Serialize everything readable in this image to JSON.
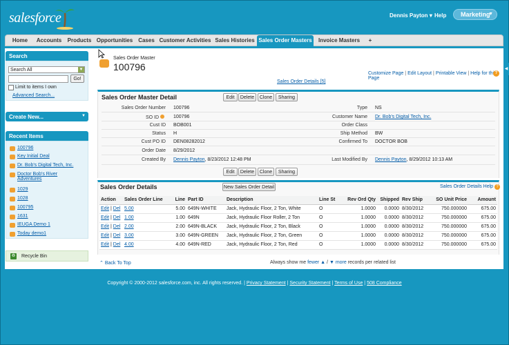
{
  "header": {
    "logo_text": "salesforce",
    "user_name": "Dennis Payton",
    "help_label": "Help",
    "app_menu_label": "Marketing"
  },
  "tabs": [
    {
      "label": "Home"
    },
    {
      "label": "Accounts"
    },
    {
      "label": "Products"
    },
    {
      "label": "Opportunities"
    },
    {
      "label": "Cases"
    },
    {
      "label": "Customer Activities"
    },
    {
      "label": "Sales Histories"
    },
    {
      "label": "Sales Order Masters",
      "active": true
    },
    {
      "label": "Invoice Masters"
    },
    {
      "label": "+"
    }
  ],
  "sidebar": {
    "search_title": "Search",
    "search_scope": "Search All",
    "go_label": "Go!",
    "limit_label": "Limit to items I own",
    "advanced_search": "Advanced Search...",
    "create_new": "Create New...",
    "recent_title": "Recent Items",
    "recent_items": [
      "100796",
      "Key Initial Deal",
      "Dr. Bob's Digital Tech, Inc.",
      "Doctor Bob's River Adventures",
      "1029",
      "1028",
      "100795",
      "1631",
      "IEUGA Demo 1",
      "Today demo1"
    ],
    "recycle_bin": "Recycle Bin"
  },
  "page": {
    "object_type": "Sales Order Master",
    "title": "100796",
    "links": [
      "Customize Page",
      "Edit Layout",
      "Printable View",
      "Help for this Page"
    ],
    "help_icon": "?",
    "details_link": "Sales Order Details [5]"
  },
  "detail": {
    "section_title": "Sales Order Master Detail",
    "buttons": [
      "Edit",
      "Delete",
      "Clone",
      "Sharing"
    ],
    "left_fields": [
      {
        "label": "Sales Order Number",
        "value": "100796"
      },
      {
        "label": "SO ID",
        "value": "100796"
      },
      {
        "label": "Cust ID",
        "value": "BOB001"
      },
      {
        "label": "Status",
        "value": "H"
      },
      {
        "label": "Cust PO ID",
        "value": "DEN08282012"
      },
      {
        "label": "Order Date",
        "value": "8/29/2012"
      },
      {
        "label": "Created By",
        "value": "Dennis Payton",
        "suffix": ", 8/23/2012 12:48 PM"
      }
    ],
    "right_fields": [
      {
        "label": "Type",
        "value": "NS"
      },
      {
        "label": "Customer Name",
        "value": "Dr. Bob's Digital Tech, Inc."
      },
      {
        "label": "Order Class",
        "value": ""
      },
      {
        "label": "Ship Method",
        "value": "BW"
      },
      {
        "label": "Confirmed To",
        "value": "DOCTOR BOB"
      },
      {
        "label": "",
        "value": ""
      },
      {
        "label": "Last Modified By",
        "value": "Dennis Payton",
        "suffix": ", 8/29/2012 10:13 AM"
      }
    ]
  },
  "related": {
    "title": "Sales Order Details",
    "new_button": "New Sales Order Detail",
    "help": "Sales Order Details Help",
    "columns": [
      "Action",
      "Sales Order Line",
      "Line",
      "Part ID",
      "Description",
      "Line St",
      "Rev Ord Qty",
      "Shipped",
      "Rev Ship",
      "SO Unit Price",
      "Amount"
    ],
    "rows": [
      {
        "edit": "Edit",
        "del": "Del",
        "sol": "5.00",
        "line": "5.00",
        "part": "649N-WHITE",
        "desc": "Jack, Hydraulic Floor, 2 Ton, White",
        "st": "O",
        "qty": "1.0000",
        "shipped": "0.0000",
        "rev_ship": "8/30/2012",
        "price": "750.000000",
        "amount": "675.00"
      },
      {
        "edit": "Edit",
        "del": "Del",
        "sol": "1.00",
        "line": "1.00",
        "part": "649N",
        "desc": "Jack, Hydraulic Floor Roller, 2 Ton",
        "st": "O",
        "qty": "1.0000",
        "shipped": "0.0000",
        "rev_ship": "8/30/2012",
        "price": "750.000000",
        "amount": "675.00"
      },
      {
        "edit": "Edit",
        "del": "Del",
        "sol": "2.00",
        "line": "2.00",
        "part": "649N-BLACK",
        "desc": "Jack, Hydraulic Floor, 2 Ton, Black",
        "st": "O",
        "qty": "1.0000",
        "shipped": "0.0000",
        "rev_ship": "8/30/2012",
        "price": "750.000000",
        "amount": "675.00"
      },
      {
        "edit": "Edit",
        "del": "Del",
        "sol": "3.00",
        "line": "3.00",
        "part": "649N-GREEN",
        "desc": "Jack, Hydraulic Floor, 2 Ton, Green",
        "st": "O",
        "qty": "1.0000",
        "shipped": "0.0000",
        "rev_ship": "8/30/2012",
        "price": "750.000000",
        "amount": "675.00"
      },
      {
        "edit": "Edit",
        "del": "Del",
        "sol": "4.00",
        "line": "4.00",
        "part": "649N-RED",
        "desc": "Jack, Hydraulic Floor, 2 Ton, Red",
        "st": "O",
        "qty": "1.0000",
        "shipped": "0.0000",
        "rev_ship": "8/30/2012",
        "price": "750.000000",
        "amount": "675.00"
      }
    ],
    "back_to_top": "Back To Top",
    "show_prefix": "Always show me ",
    "fewer": "fewer",
    "more": "more",
    "show_suffix": " records per related list"
  },
  "footer": {
    "copyright": "Copyright © 2000-2012 salesforce.com, inc. All rights reserved.",
    "links": [
      "Privacy Statement",
      "Security Statement",
      "Terms of Use",
      "508 Compliance"
    ]
  },
  "colors": {
    "brand": "#1797c0",
    "link": "#015ba7",
    "accent": "#f0a030"
  }
}
